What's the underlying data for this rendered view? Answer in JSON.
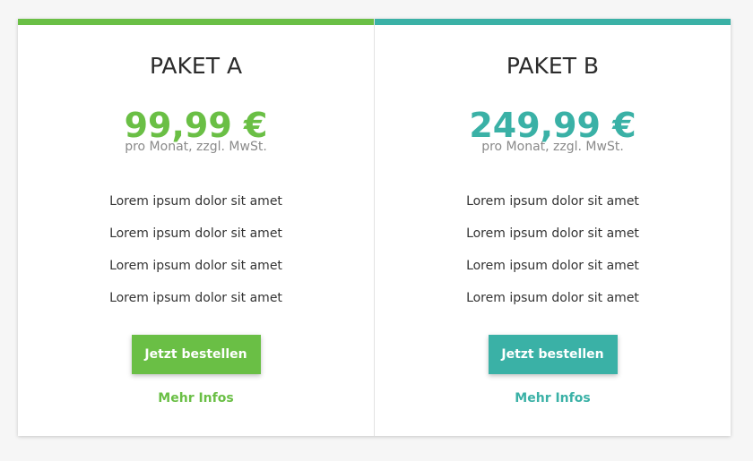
{
  "colors": {
    "package_a": "#6abf45",
    "package_b": "#3ab1a6"
  },
  "packages": [
    {
      "title": "PAKET A",
      "price": "99,99 €",
      "subtitle": "pro Monat, zzgl. MwSt.",
      "features": [
        "Lorem ipsum dolor sit amet",
        "Lorem ipsum dolor sit amet",
        "Lorem ipsum dolor sit amet",
        "Lorem ipsum dolor sit amet"
      ],
      "button": "Jetzt bestellen",
      "link": "Mehr Infos"
    },
    {
      "title": "PAKET B",
      "price": "249,99 €",
      "subtitle": "pro Monat, zzgl. MwSt.",
      "features": [
        "Lorem ipsum dolor sit amet",
        "Lorem ipsum dolor sit amet",
        "Lorem ipsum dolor sit amet",
        "Lorem ipsum dolor sit amet"
      ],
      "button": "Jetzt bestellen",
      "link": "Mehr Infos"
    }
  ]
}
